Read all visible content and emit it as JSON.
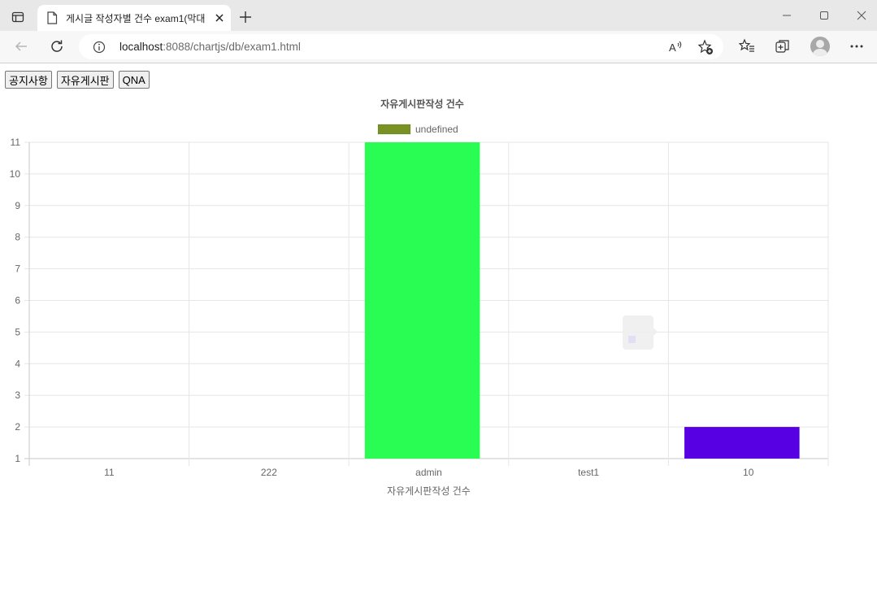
{
  "browser": {
    "tab_title": "게시글 작성자별 건수 exam1(막대",
    "url_host": "localhost",
    "url_path": ":8088/chartjs/db/exam1.html"
  },
  "page": {
    "buttons": [
      "공지사항",
      "자유게시판",
      "QNA"
    ]
  },
  "chart_data": {
    "type": "bar",
    "title": "자유게시판작성 건수",
    "legend_label": "undefined",
    "legend_color": "#7a9223",
    "legend_position": "top-center",
    "categories": [
      "11",
      "222",
      "admin",
      "test1",
      "10"
    ],
    "values": [
      1,
      1,
      11,
      1,
      2
    ],
    "bar_colors": [
      "#cccccc",
      "#cccccc",
      "#29fd53",
      "#cccccc",
      "#5600e3"
    ],
    "xlabel": "자유게시판작성 건수",
    "ylabel": "",
    "ylim": [
      1,
      11
    ],
    "yticks": [
      1,
      2,
      3,
      4,
      5,
      6,
      7,
      8,
      9,
      10,
      11
    ],
    "grid": true
  }
}
